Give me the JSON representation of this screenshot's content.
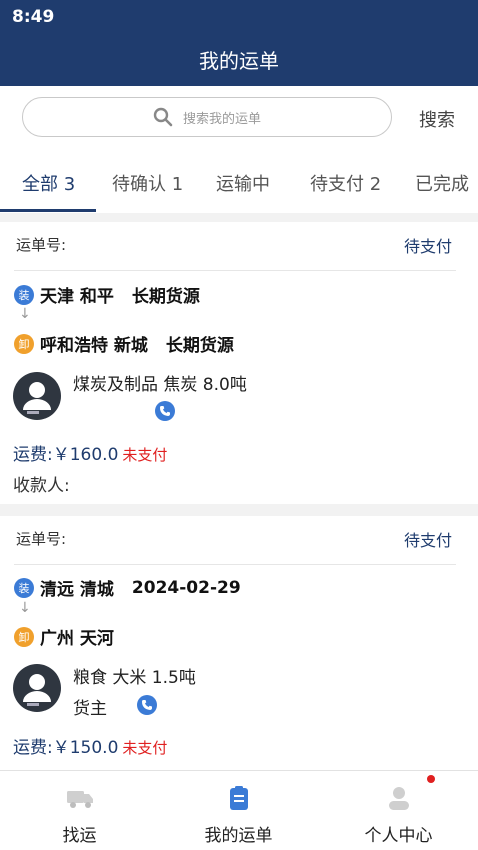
{
  "status_bar": {
    "time": "8:49"
  },
  "header": {
    "title": "我的运单"
  },
  "search": {
    "placeholder": "搜索我的运单",
    "button_label": "搜索"
  },
  "tabs": [
    {
      "label": "全部 3",
      "active": true
    },
    {
      "label": "待确认 1"
    },
    {
      "label": "运输中"
    },
    {
      "label": "待支付 2"
    },
    {
      "label": "已完成"
    }
  ],
  "orders": [
    {
      "waybill_label": "运单号:",
      "status": "待支付",
      "load": {
        "badge": "装",
        "place": "天津 和平",
        "extra": "长期货源"
      },
      "arrow": "↓",
      "unload": {
        "badge": "卸",
        "place": "呼和浩特 新城",
        "extra": "长期货源"
      },
      "cargo": "煤炭及制品  焦炭 8.0吨",
      "owner": "",
      "fee_label": "运费:",
      "fee_amount": "￥160.0",
      "fee_status": "未支付",
      "payee_label": "收款人:"
    },
    {
      "waybill_label": "运单号:",
      "status": "待支付",
      "load": {
        "badge": "装",
        "place": "清远 清城",
        "extra": "2024-02-29"
      },
      "arrow": "↓",
      "unload": {
        "badge": "卸",
        "place": "广州 天河",
        "extra": ""
      },
      "cargo": "粮食  大米 1.5吨",
      "owner": "货主",
      "fee_label": "运费:",
      "fee_amount": "￥150.0",
      "fee_status": "未支付"
    }
  ],
  "bottom_nav": [
    {
      "label": "找运",
      "icon": "truck-icon"
    },
    {
      "label": "我的运单",
      "icon": "clipboard-icon",
      "active": true
    },
    {
      "label": "个人中心",
      "icon": "user-icon"
    }
  ],
  "colors": {
    "primary": "#1f3c6e",
    "accent": "#3b7bd6",
    "unpaid": "#e02020",
    "unload_badge": "#f0a02c"
  }
}
